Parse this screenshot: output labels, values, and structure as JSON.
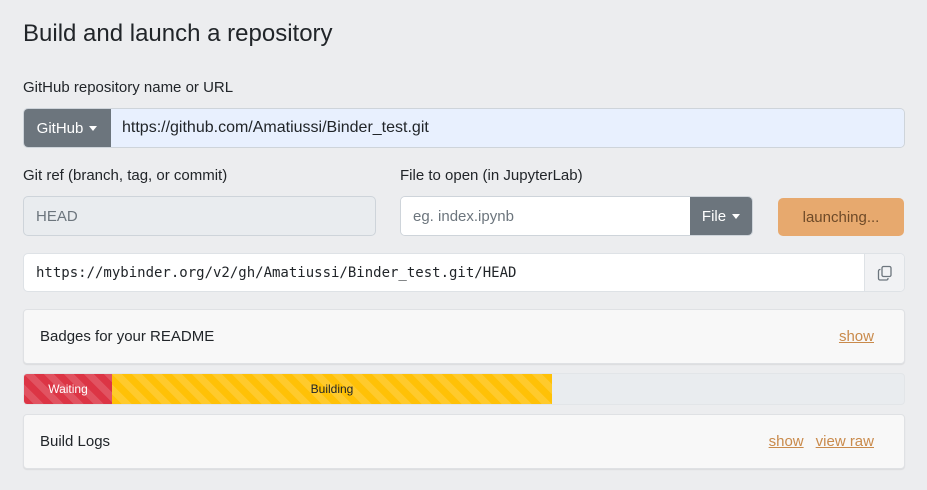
{
  "title": "Build and launch a repository",
  "repo": {
    "label": "GitHub repository name or URL",
    "provider": "GitHub",
    "value": "https://github.com/Amatiussi/Binder_test.git"
  },
  "ref": {
    "label": "Git ref (branch, tag, or commit)",
    "value": "HEAD"
  },
  "file": {
    "label": "File to open (in JupyterLab)",
    "placeholder": "eg. index.ipynb",
    "type_button": "File"
  },
  "launch_button": "launching...",
  "binder_url": "https://mybinder.org/v2/gh/Amatiussi/Binder_test.git/HEAD",
  "badges": {
    "title": "Badges for your README",
    "show_link": "show"
  },
  "progress": {
    "waiting_label": "Waiting",
    "waiting_fraction": 0.1,
    "building_label": "Building",
    "building_fraction": 0.5,
    "waiting_color": "#dc3545",
    "building_color": "#ffc107"
  },
  "build_logs": {
    "title": "Build Logs",
    "show_link": "show",
    "view_raw_link": "view raw"
  },
  "colors": {
    "background": "#ecedef",
    "secondary_button": "#6c757d",
    "launch_button": "#e7a96e",
    "link": "#c98a4b"
  },
  "icons": {
    "copy": "copy-icon",
    "caret": "caret-down-icon"
  }
}
